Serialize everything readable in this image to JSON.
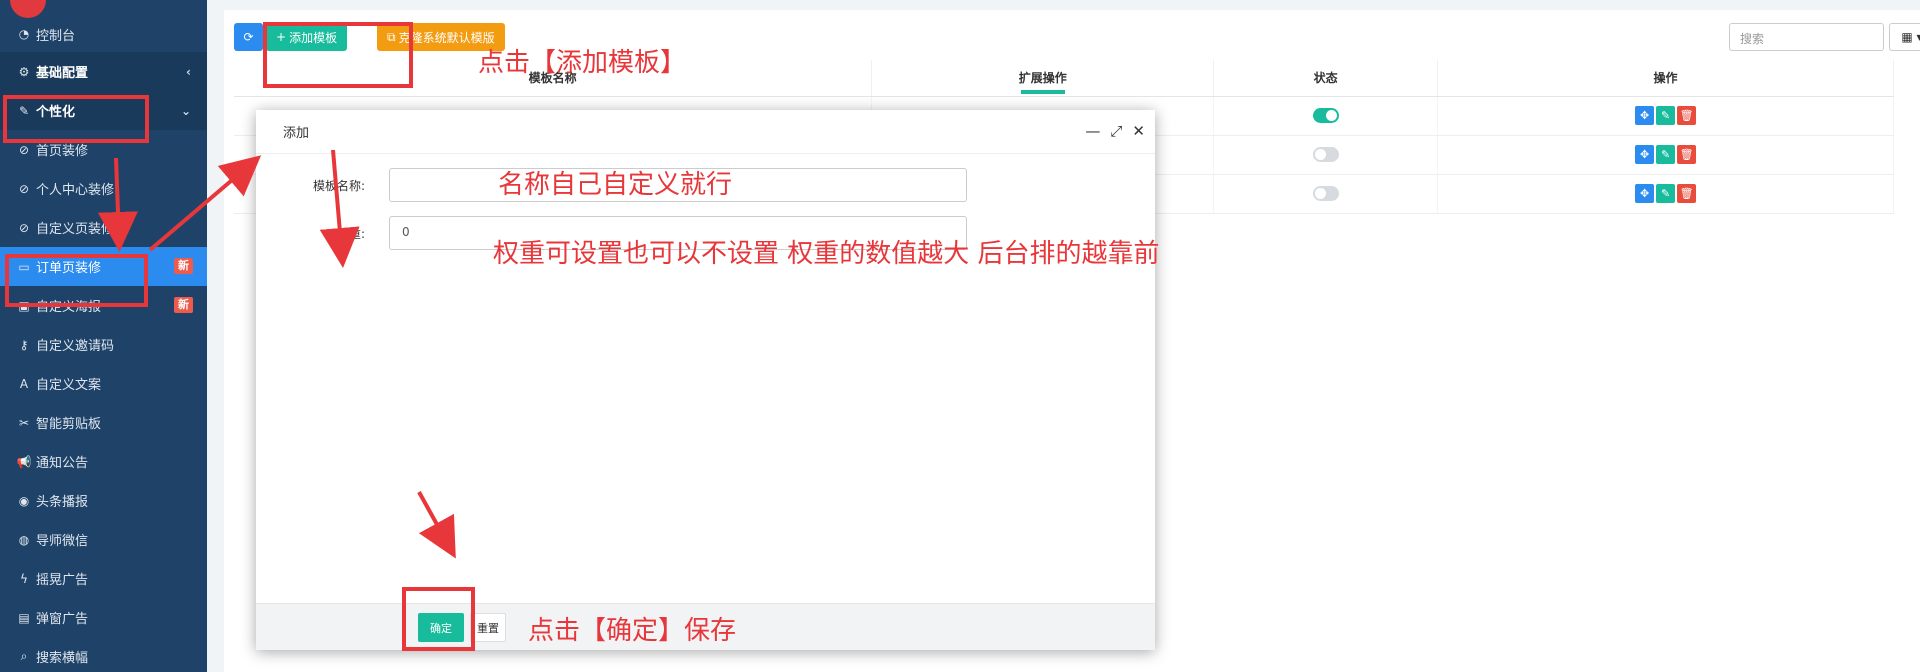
{
  "sidebar": {
    "items": [
      {
        "icon": "dashboard-icon",
        "glyph": "◔",
        "label": "控制台"
      },
      {
        "icon": "cogs-icon",
        "glyph": "⚙",
        "label": "基础配置"
      },
      {
        "icon": "magic-wand-icon",
        "glyph": "✎",
        "label": "个性化"
      },
      {
        "icon": "paint-icon",
        "glyph": "⊘",
        "label": "首页装修"
      },
      {
        "icon": "paint-icon",
        "glyph": "⊘",
        "label": "个人中心装修"
      },
      {
        "icon": "paint-icon",
        "glyph": "⊘",
        "label": "自定义页装修"
      },
      {
        "icon": "window-icon",
        "glyph": "▭",
        "label": "订单页装修",
        "badge": "新"
      },
      {
        "icon": "image-icon",
        "glyph": "▣",
        "label": "自定义海报",
        "badge": "新"
      },
      {
        "icon": "key-icon",
        "glyph": "⚷",
        "label": "自定义邀请码"
      },
      {
        "icon": "font-icon",
        "glyph": "A",
        "label": "自定义文案"
      },
      {
        "icon": "scissors-icon",
        "glyph": "✂",
        "label": "智能剪贴板"
      },
      {
        "icon": "bullhorn-icon",
        "glyph": "📢",
        "label": "通知公告"
      },
      {
        "icon": "podcast-icon",
        "glyph": "◉",
        "label": "头条播报"
      },
      {
        "icon": "wechat-icon",
        "glyph": "◍",
        "label": "导师微信"
      },
      {
        "icon": "bolt-icon",
        "glyph": "ϟ",
        "label": "摇晃广告"
      },
      {
        "icon": "popup-icon",
        "glyph": "▤",
        "label": "弹窗广告"
      },
      {
        "icon": "search-icon",
        "glyph": "⌕",
        "label": "搜索横幅"
      }
    ]
  },
  "toolbar": {
    "refresh_glyph": "⟳",
    "add_label": "添加模板",
    "clone_label": "克隆系统默认模版",
    "search_placeholder": "搜索",
    "grid_glyph": "▦ ▾"
  },
  "table": {
    "columns": [
      "模板名称",
      "扩展操作",
      "状态",
      "操作"
    ],
    "rows": [
      {
        "status": "on"
      },
      {
        "status": "off"
      },
      {
        "status": "off"
      }
    ],
    "op_glyphs": {
      "move": "✥",
      "edit": "✎",
      "del": "🗑"
    }
  },
  "modal": {
    "title": "添加",
    "controls": {
      "minimize": "—",
      "maximize": "⤢",
      "close": "✕"
    },
    "fields": [
      {
        "label": "模板名称:",
        "value": ""
      },
      {
        "label": "权重:",
        "value": "0"
      }
    ],
    "ok_label": "确定",
    "reset_label": "重置"
  },
  "annotations": {
    "click_add": "点击【添加模板】",
    "name_hint": "名称自己自定义就行",
    "weight_hint": "权重可设置也可以不设置    权重的数值越大 后台排的越靠前",
    "click_ok": "点击【确定】保存"
  }
}
